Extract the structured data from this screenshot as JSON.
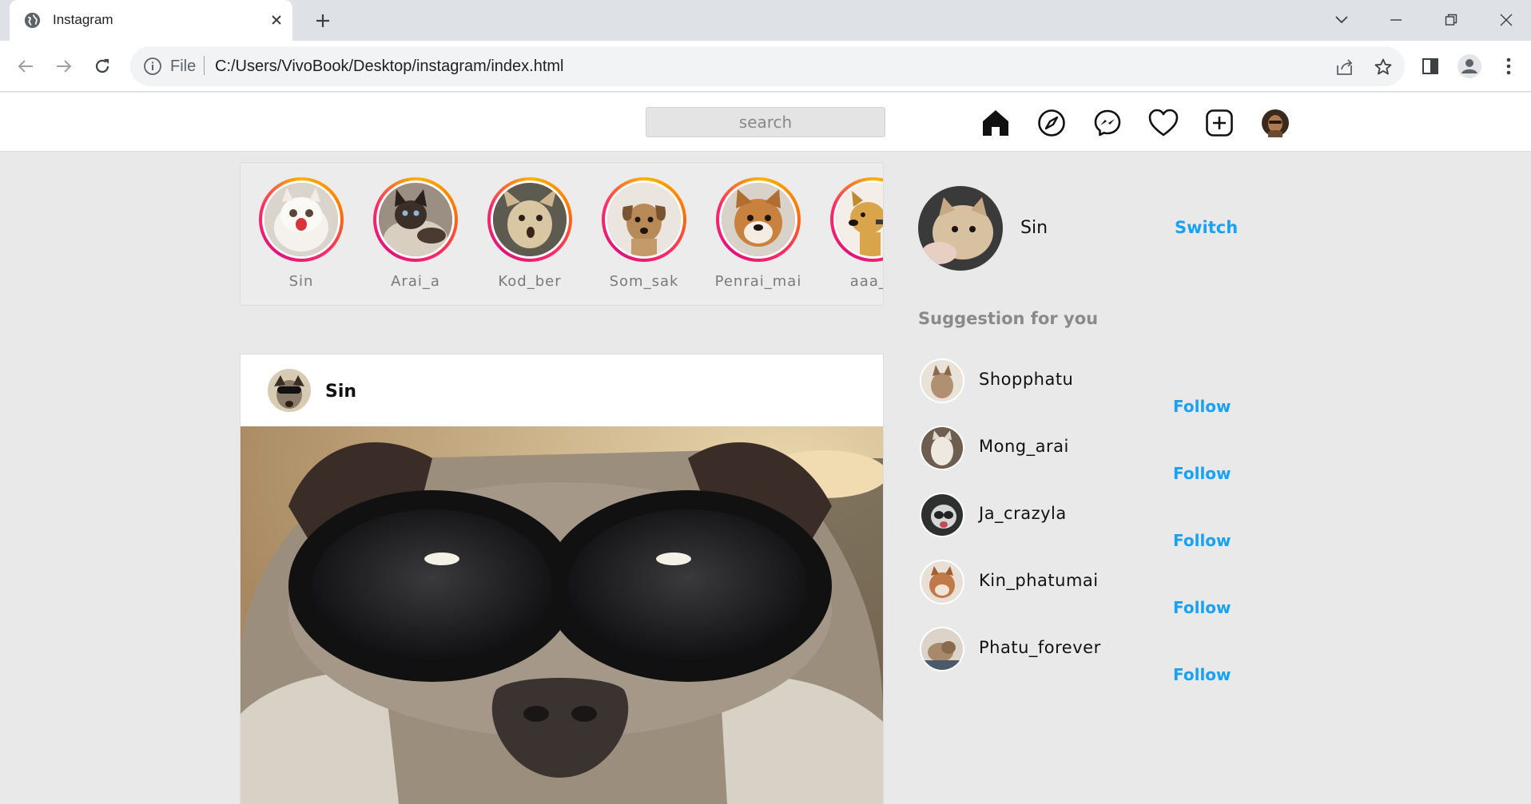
{
  "browser": {
    "tab_title": "Instagram",
    "url_scheme": "File",
    "url": "C:/Users/VivoBook/Desktop/instagram/index.html"
  },
  "header": {
    "search_placeholder": "search",
    "nav_icons": [
      "home-icon",
      "explore-compass-icon",
      "messenger-icon",
      "heart-icon",
      "add-post-icon",
      "profile-avatar-icon"
    ]
  },
  "stories": [
    {
      "name": "Sin"
    },
    {
      "name": "Arai_a"
    },
    {
      "name": "Kod_ber"
    },
    {
      "name": "Som_sak"
    },
    {
      "name": "Penrai_mai"
    },
    {
      "name": "aaa_s"
    }
  ],
  "post": {
    "username": "Sin"
  },
  "sidebar": {
    "profile_name": "Sin",
    "switch_label": "Switch",
    "suggestion_title": "Suggestion for you",
    "suggestions": [
      {
        "name": "Shopphatu",
        "action": "Follow"
      },
      {
        "name": "Mong_arai",
        "action": "Follow"
      },
      {
        "name": "Ja_crazyla",
        "action": "Follow"
      },
      {
        "name": "Kin_phatumai",
        "action": "Follow"
      },
      {
        "name": "Phatu_forever",
        "action": "Follow"
      }
    ]
  },
  "colors": {
    "link_blue": "#1ba1f2",
    "page_bg": "#e9e9e9",
    "story_ring": "#e1127a"
  }
}
